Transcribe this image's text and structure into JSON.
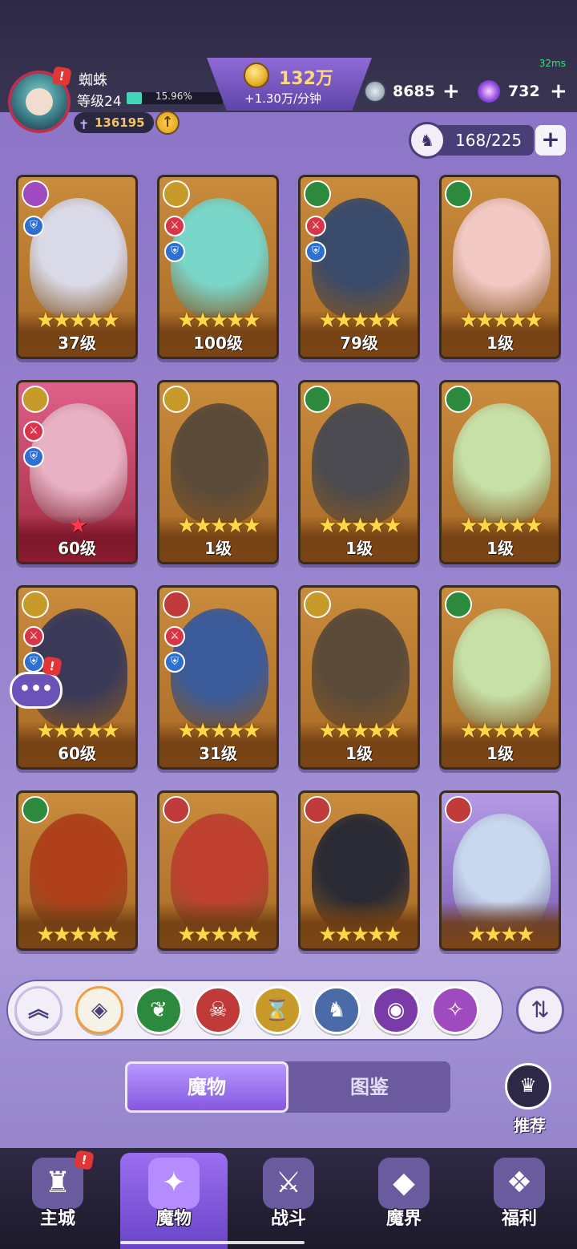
{
  "status": {
    "fps": "32ms"
  },
  "player": {
    "name": "蜘蛛",
    "level": "等级24",
    "xp_percent": "15.96%",
    "xp_fraction": 0.16,
    "power": "136195",
    "avatar_badge": "!"
  },
  "currency": {
    "gold": "132万",
    "gold_rate": "+1.30万/分钟",
    "gems": "8685",
    "stars": "732",
    "plus": "+"
  },
  "capacity": {
    "value": "168/225",
    "plus": "+"
  },
  "cards": [
    {
      "level": "37级",
      "stars": "★★★★★",
      "faction_icon": "spiral-icon",
      "faction_color": "#a04ac0",
      "art_color": "#d9d9e8"
    },
    {
      "level": "100级",
      "stars": "★★★★★",
      "faction_icon": "hourglass-icon",
      "faction_color": "#c89a2a",
      "art_color": "#7ad6c9"
    },
    {
      "level": "79级",
      "stars": "★★★★★",
      "faction_icon": "leaf-icon",
      "faction_color": "#2c8a3e",
      "art_color": "#3a4a6a"
    },
    {
      "level": "1级",
      "stars": "★★★★★",
      "faction_icon": "leaf-icon",
      "faction_color": "#2c8a3e",
      "art_color": "#f2c9c4"
    },
    {
      "level": "60级",
      "stars": "★",
      "faction_icon": "hourglass-icon",
      "faction_color": "#c89a2a",
      "art_color": "#e8b2c4"
    },
    {
      "level": "1级",
      "stars": "★★★★★",
      "faction_icon": "hourglass-icon",
      "faction_color": "#c89a2a",
      "art_color": "#5a4a3a"
    },
    {
      "level": "1级",
      "stars": "★★★★★",
      "faction_icon": "leaf-icon",
      "faction_color": "#2c8a3e",
      "art_color": "#4a4a50"
    },
    {
      "level": "1级",
      "stars": "★★★★★",
      "faction_icon": "leaf-icon",
      "faction_color": "#2c8a3e",
      "art_color": "#c6e0a8"
    },
    {
      "level": "60级",
      "stars": "★★★★★",
      "faction_icon": "hourglass-icon",
      "faction_color": "#c89a2a",
      "art_color": "#3a3a58"
    },
    {
      "level": "31级",
      "stars": "★★★★★",
      "faction_icon": "demon-icon",
      "faction_color": "#c03a3a",
      "art_color": "#3a5a9a"
    },
    {
      "level": "1级",
      "stars": "★★★★★",
      "faction_icon": "hourglass-icon",
      "faction_color": "#c89a2a",
      "art_color": "#5a4a3a"
    },
    {
      "level": "1级",
      "stars": "★★★★★",
      "faction_icon": "leaf-icon",
      "faction_color": "#2c8a3e",
      "art_color": "#c6e0a8"
    },
    {
      "level": "",
      "stars": "★★★★★",
      "faction_icon": "leaf-icon",
      "faction_color": "#2c8a3e",
      "art_color": "#b0401a"
    },
    {
      "level": "",
      "stars": "★★★★★",
      "faction_icon": "demon-icon",
      "faction_color": "#c03a3a",
      "art_color": "#c04030"
    },
    {
      "level": "",
      "stars": "★★★★★",
      "faction_icon": "demon-icon",
      "faction_color": "#c03a3a",
      "art_color": "#2a2a34"
    },
    {
      "level": "",
      "stars": "★★★★",
      "faction_icon": "demon-icon",
      "faction_color": "#c03a3a",
      "art_color": "#c8d8ee"
    }
  ],
  "filters": [
    {
      "icon": "chevron-up-icon",
      "color": "#f1eef8",
      "glyph": "︽"
    },
    {
      "icon": "all-icon",
      "color": "#f6f2e8",
      "glyph": "◈"
    },
    {
      "icon": "leaf-icon",
      "color": "#2c8a3e",
      "glyph": "❦"
    },
    {
      "icon": "demon-icon",
      "color": "#c03a3a",
      "glyph": "☠"
    },
    {
      "icon": "hourglass-icon",
      "color": "#c89a2a",
      "glyph": "⌛"
    },
    {
      "icon": "dragon-icon",
      "color": "#4a6aa8",
      "glyph": "♞"
    },
    {
      "icon": "eye-icon",
      "color": "#7a3aa8",
      "glyph": "◉"
    },
    {
      "icon": "spiral-icon",
      "color": "#a04ac0",
      "glyph": "✧"
    }
  ],
  "sort_glyph": "⇅",
  "tabs": {
    "active": "魔物",
    "inactive": "图鉴"
  },
  "recommend": {
    "label": "推荐"
  },
  "chat_glyph": "•••",
  "nav": [
    {
      "label": "主城",
      "icon": "castle-icon",
      "glyph": "♜",
      "color": "#6a5a9e"
    },
    {
      "label": "魔物",
      "icon": "flame-icon",
      "glyph": "✦",
      "color": "#b48cff"
    },
    {
      "label": "战斗",
      "icon": "sword-icon",
      "glyph": "⚔",
      "color": "#6a5a9e"
    },
    {
      "label": "魔界",
      "icon": "portal-icon",
      "glyph": "◆",
      "color": "#6a5a9e"
    },
    {
      "label": "福利",
      "icon": "chest-icon",
      "glyph": "❖",
      "color": "#6a5a9e"
    }
  ]
}
